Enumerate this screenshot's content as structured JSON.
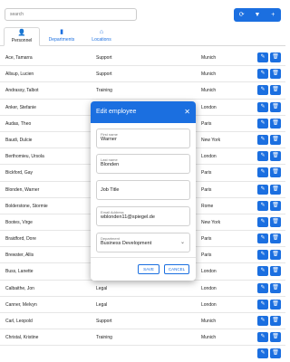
{
  "toolbar": {
    "search_placeholder": "search",
    "refresh_icon": "⟳",
    "filter_icon": "▼",
    "add_icon": "+"
  },
  "tabs": [
    {
      "label": "Personnel",
      "icon": "👤"
    },
    {
      "label": "Departments",
      "icon": "▮"
    },
    {
      "label": "Locations",
      "icon": "⌂"
    }
  ],
  "rows": [
    {
      "name": "Ace, Tamarra",
      "department": "Support",
      "location": "Munich"
    },
    {
      "name": "Allsup, Lucien",
      "department": "Support",
      "location": "Munich"
    },
    {
      "name": "Andrassy, Talbot",
      "department": "Training",
      "location": "Munich"
    },
    {
      "name": "Anker, Stefanie",
      "department": "",
      "location": "London"
    },
    {
      "name": "Audas, Theo",
      "department": "",
      "location": "Paris"
    },
    {
      "name": "Baudi, Dulcie",
      "department": "",
      "location": "New York"
    },
    {
      "name": "Berthomieu, Ursola",
      "department": "",
      "location": "London"
    },
    {
      "name": "Bickford, Gay",
      "department": "",
      "location": "Paris"
    },
    {
      "name": "Blonden, Warner",
      "department": "",
      "location": "Paris"
    },
    {
      "name": "Bolderstone, Stormie",
      "department": "",
      "location": "Rome"
    },
    {
      "name": "Bootes, Virge",
      "department": "",
      "location": "New York"
    },
    {
      "name": "Braidford, Dore",
      "department": "",
      "location": "Paris"
    },
    {
      "name": "Brewster, Allis",
      "department": "",
      "location": "Paris"
    },
    {
      "name": "Buss, Lanette",
      "department": "",
      "location": "London"
    },
    {
      "name": "Calbaithe, Jon",
      "department": "Legal",
      "location": "London"
    },
    {
      "name": "Canner, Melvyn",
      "department": "Legal",
      "location": "London"
    },
    {
      "name": "Carl, Leopold",
      "department": "Support",
      "location": "Munich"
    },
    {
      "name": "Christal, Kristine",
      "department": "Training",
      "location": "Munich"
    },
    {
      "name": "",
      "department": "",
      "location": ""
    }
  ],
  "row_actions": {
    "edit_icon": "✎",
    "delete_icon": "🗑"
  },
  "modal": {
    "title": "Edit employee",
    "close_icon": "✕",
    "first_name_label": "First name",
    "first_name_value": "Warner",
    "last_name_label": "Last name",
    "last_name_value": "Blonden",
    "job_title_placeholder": "Job Title",
    "email_label": "Email Address",
    "email_value": "wblonden11@spiegel.de",
    "department_label": "Department",
    "department_value": "Business Development",
    "save_label": "SAVE",
    "cancel_label": "CANCEL"
  },
  "colors": {
    "accent": "#1b6fe0"
  }
}
